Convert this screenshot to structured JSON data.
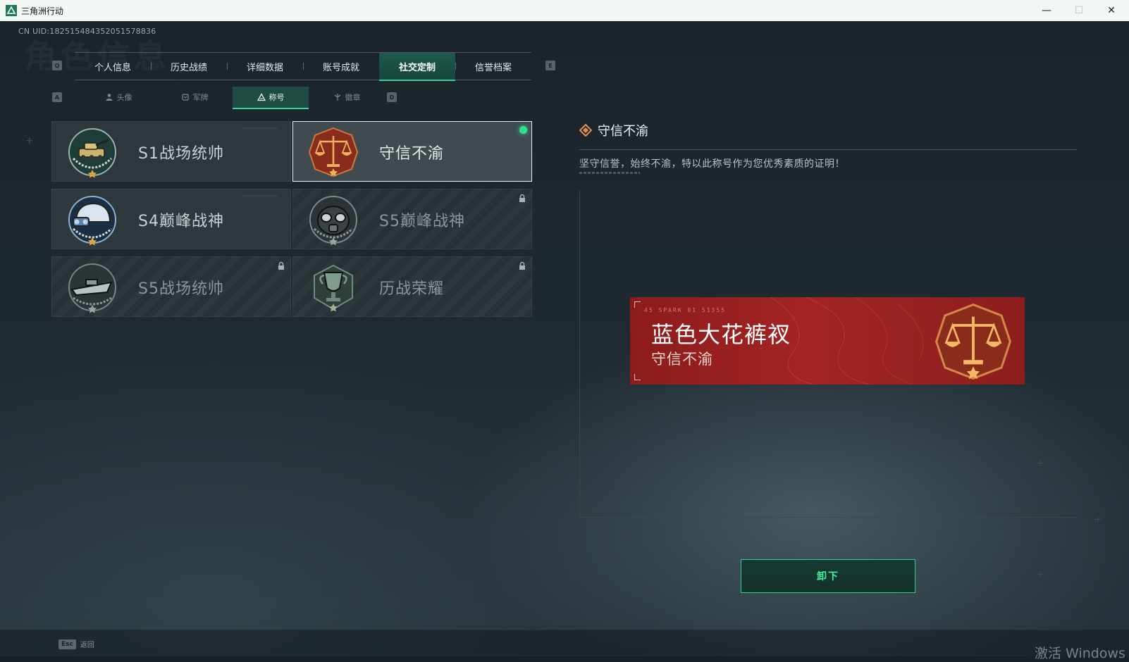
{
  "window": {
    "title": "三角洲行动",
    "controls": {
      "minimize": "—",
      "maximize": "☐",
      "close": "✕"
    }
  },
  "uid": "CN UID:18251548435205157883­6",
  "background_heading": "角色信息",
  "main_tabs": {
    "prev_key": "Q",
    "next_key": "E",
    "items": [
      {
        "label": "个人信息",
        "active": false
      },
      {
        "label": "历史战绩",
        "active": false
      },
      {
        "label": "详细数据",
        "active": false
      },
      {
        "label": "账号成就",
        "active": false
      },
      {
        "label": "社交定制",
        "active": true
      },
      {
        "label": "信誉档案",
        "active": false
      }
    ]
  },
  "sub_tabs": {
    "prev_key": "A",
    "next_key": "D",
    "items": [
      {
        "label": "头像",
        "icon": "person-icon",
        "active": false
      },
      {
        "label": "军牌",
        "icon": "dogtag-icon",
        "active": false
      },
      {
        "label": "称号",
        "icon": "triangle-title-icon",
        "active": true
      },
      {
        "label": "徽章",
        "icon": "badge-icon",
        "active": false
      }
    ]
  },
  "titles": [
    {
      "name": "S1战场统帅",
      "emblem": "tank-emblem-icon",
      "locked": false,
      "selected": false
    },
    {
      "name": "守信不渝",
      "emblem": "scales-emblem-icon",
      "locked": false,
      "selected": true,
      "equipped": true
    },
    {
      "name": "S4巅峰战神",
      "emblem": "helmet-emblem-icon",
      "locked": false,
      "selected": false
    },
    {
      "name": "S5巅峰战神",
      "emblem": "gasmask-emblem-icon",
      "locked": true,
      "selected": false
    },
    {
      "name": "S5战场统帅",
      "emblem": "boat-emblem-icon",
      "locked": true,
      "selected": false
    },
    {
      "name": "历战荣耀",
      "emblem": "trophy-emblem-icon",
      "locked": true,
      "selected": false
    }
  ],
  "detail": {
    "title": "守信不渝",
    "description": "坚守信誉，始终不渝，特以此称号作为您优秀素质的证明！"
  },
  "preview": {
    "player_name": "蓝色大花裤衩",
    "title": "守信不渝",
    "code": "45 SPARK  01 51355"
  },
  "unequip_label": "卸下",
  "bottom": {
    "esc_key": "Esc",
    "esc_label": "返回",
    "watermark": "激活 Windows"
  },
  "colors": {
    "accent": "#31d39c",
    "banner_red": "#a32424",
    "equipped_dot": "#2fe08f"
  }
}
